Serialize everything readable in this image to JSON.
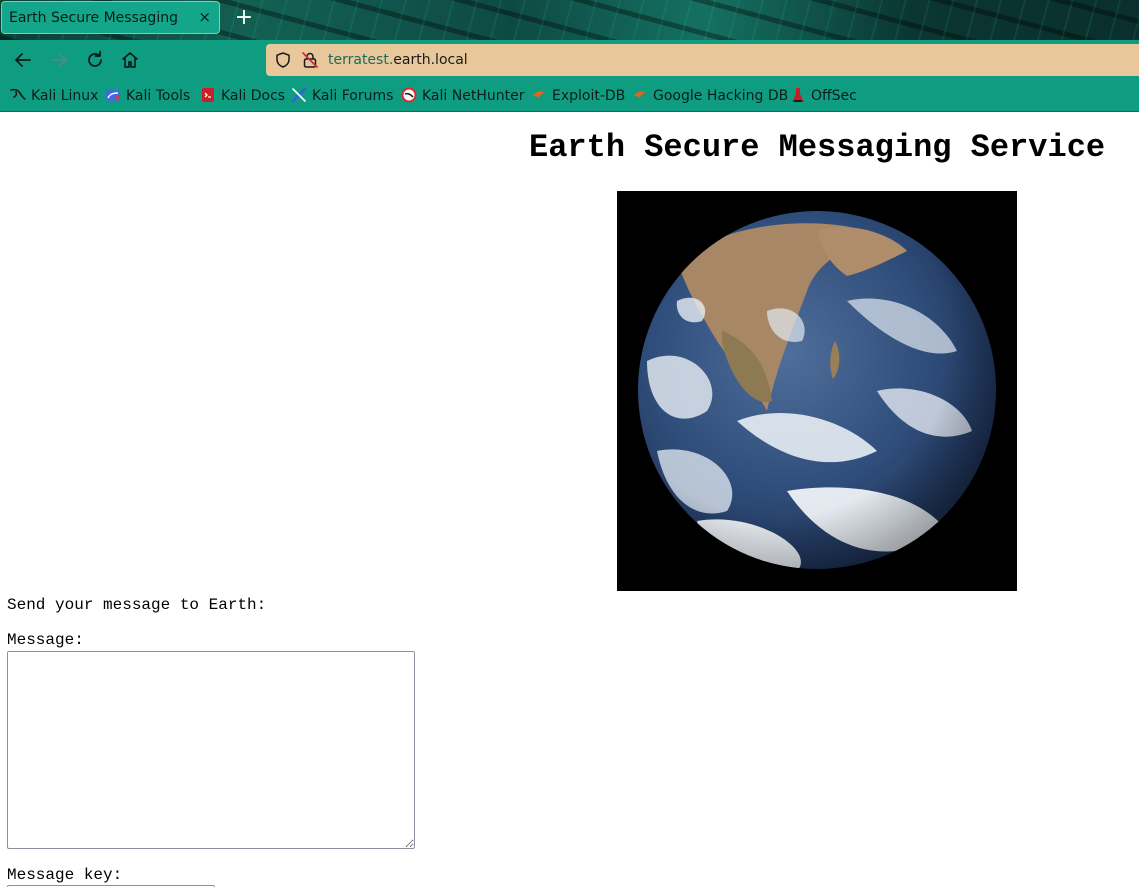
{
  "browser": {
    "tab": {
      "title": "Earth Secure Messaging",
      "close_glyph": "×"
    },
    "new_tab_glyph": "+",
    "nav": {
      "back_icon": "arrow-left-icon",
      "forward_icon": "arrow-right-icon",
      "reload_icon": "reload-icon",
      "home_icon": "home-icon"
    },
    "url": {
      "subdomain": "terratest.",
      "host": "earth.local",
      "shield_icon": "shield-icon",
      "lock_icon": "insecure-lock-icon"
    },
    "bookmarks": [
      {
        "label": "Kali Linux",
        "icon": "kali-dragon-icon"
      },
      {
        "label": "Kali Tools",
        "icon": "kali-tools-icon"
      },
      {
        "label": "Kali Docs",
        "icon": "kali-docs-icon"
      },
      {
        "label": "Kali Forums",
        "icon": "kali-forums-icon"
      },
      {
        "label": "Kali NetHunter",
        "icon": "kali-nethunter-icon"
      },
      {
        "label": "Exploit-DB",
        "icon": "exploit-db-icon"
      },
      {
        "label": "Google Hacking DB",
        "icon": "ghdb-icon"
      },
      {
        "label": "OffSec",
        "icon": "offsec-icon"
      }
    ],
    "colors": {
      "toolbar": "#0f9d81",
      "tab_active": "#14a68a",
      "urlbar": "#e8c79a"
    }
  },
  "page": {
    "title": "Earth Secure Messaging Service",
    "image": "earth-image",
    "intro": "Send your message to Earth:",
    "message_label": "Message:",
    "message_value": "",
    "key_label": "Message key:",
    "key_value": ""
  }
}
